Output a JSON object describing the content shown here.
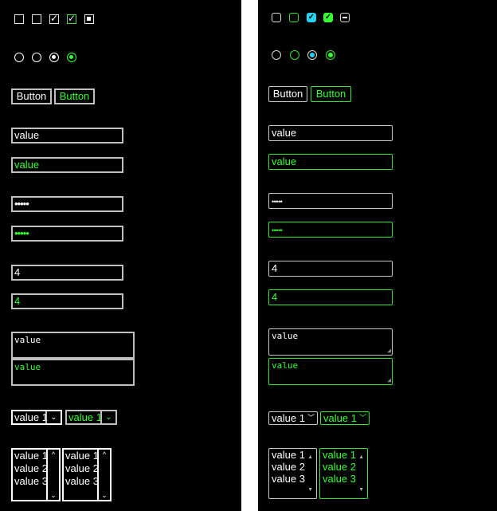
{
  "button": {
    "label": "Button"
  },
  "input": {
    "value": "value",
    "password_mask": "•••••",
    "number": "4"
  },
  "textarea": {
    "value": "value"
  },
  "select": {
    "value": "value 1"
  },
  "listbox": {
    "options": [
      "value 1",
      "value 2",
      "value 3"
    ]
  },
  "colors": {
    "white": "#ffffff",
    "green": "#33ff33",
    "cyan": "#22d3f3",
    "background": "#000000"
  },
  "icons": [
    "checkmark-icon",
    "indeterminate-icon",
    "chevron-down-icon",
    "scroll-up-icon",
    "scroll-down-icon"
  ]
}
